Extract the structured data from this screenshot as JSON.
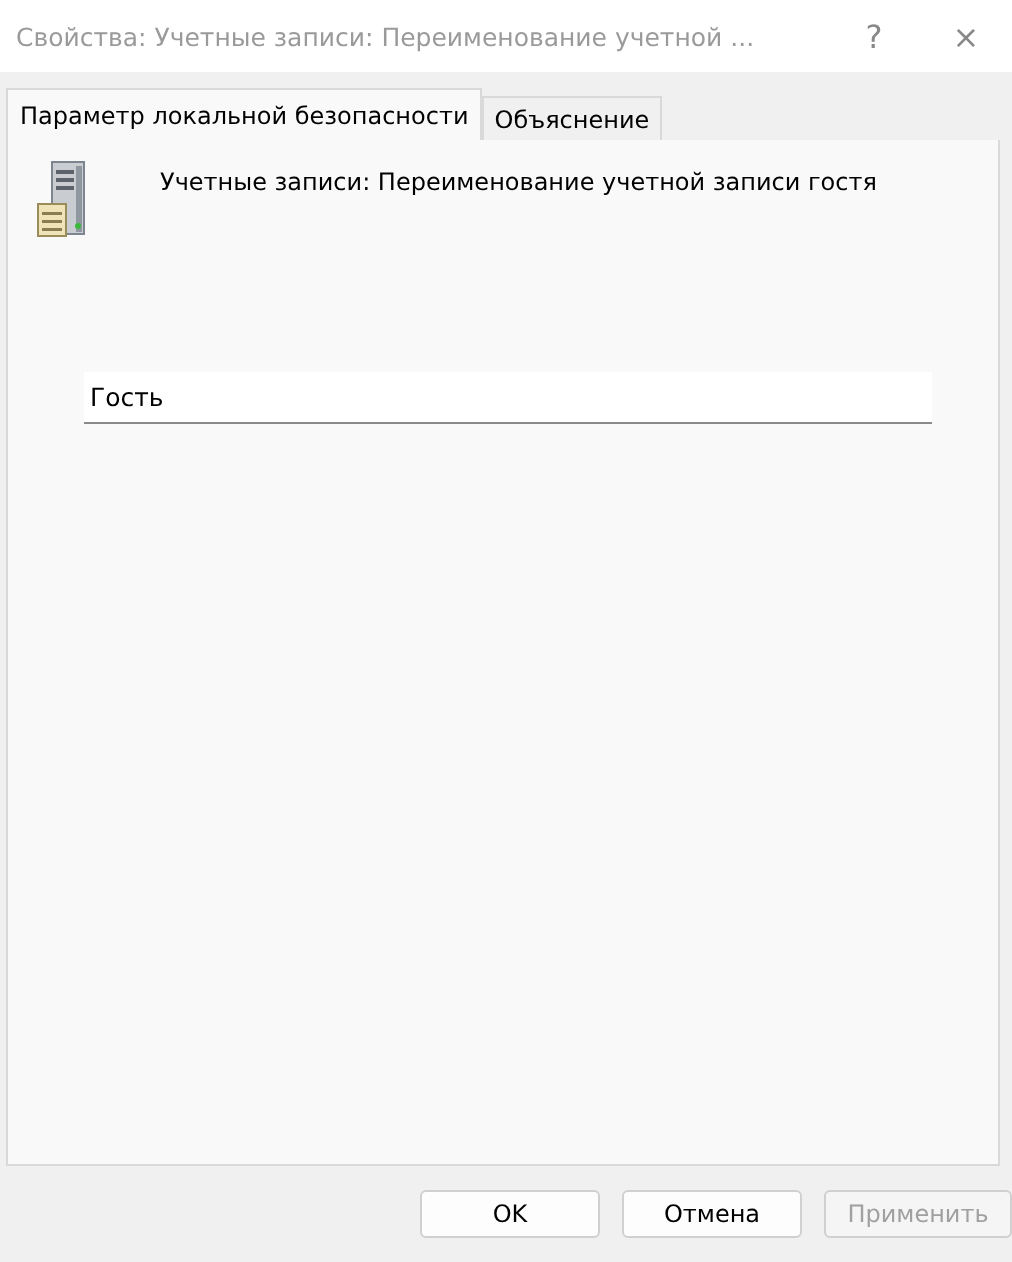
{
  "window": {
    "title": "Свойства: Учетные записи: Переименование учетной ...",
    "help": "?",
    "close": "×"
  },
  "tabs": [
    {
      "label": "Параметр локальной безопасности",
      "selected": true
    },
    {
      "label": "Объяснение",
      "selected": false
    }
  ],
  "policy": {
    "title": "Учетные записи: Переименование учетной записи гостя"
  },
  "field": {
    "value": "Гость"
  },
  "buttons": [
    {
      "label": "OK",
      "disabled": false
    },
    {
      "label": "Отмена",
      "disabled": false
    },
    {
      "label": "Применить",
      "disabled": true
    }
  ]
}
